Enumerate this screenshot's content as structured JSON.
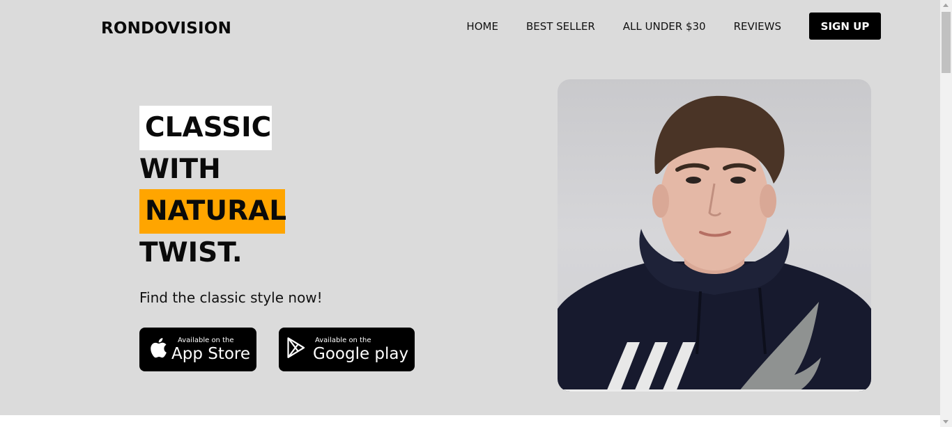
{
  "header": {
    "brand": "RONDOVISION",
    "nav": {
      "home": "HOME",
      "best_seller": "BEST SELLER",
      "all_under": "ALL UNDER $30",
      "reviews": "REVIEWS"
    },
    "signup_label": "SIGN UP"
  },
  "hero": {
    "headline": {
      "line1": "CLASSIC",
      "line2": "WITH",
      "line3": "NATURAL",
      "line4": "TWIST."
    },
    "tagline": "Find the classic style now!",
    "app_store": {
      "small": "Available on the",
      "big": "App Store",
      "icon": "apple-icon"
    },
    "google_play": {
      "small": "Available on the",
      "big": "Google play",
      "icon": "google-play-icon"
    },
    "image": "model-photo"
  },
  "colors": {
    "background": "#dbdbdb",
    "highlight_white": "#ffffff",
    "highlight_orange": "#ffa500",
    "button": "#000000"
  }
}
